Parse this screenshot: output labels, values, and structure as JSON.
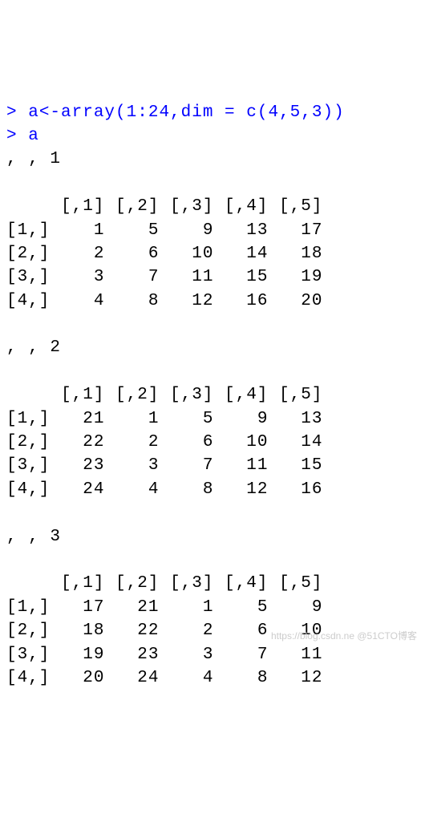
{
  "console": {
    "prompt": ">",
    "lines": [
      {
        "type": "input",
        "text": "a<-array(1:24,dim = c(4,5,3))"
      },
      {
        "type": "input",
        "text": "a"
      }
    ]
  },
  "array_output": {
    "slices": [
      {
        "header": ", , 1",
        "col_labels": [
          "[,1]",
          "[,2]",
          "[,3]",
          "[,4]",
          "[,5]"
        ],
        "row_labels": [
          "[1,]",
          "[2,]",
          "[3,]",
          "[4,]"
        ],
        "values": [
          [
            1,
            5,
            9,
            13,
            17
          ],
          [
            2,
            6,
            10,
            14,
            18
          ],
          [
            3,
            7,
            11,
            15,
            19
          ],
          [
            4,
            8,
            12,
            16,
            20
          ]
        ]
      },
      {
        "header": ", , 2",
        "col_labels": [
          "[,1]",
          "[,2]",
          "[,3]",
          "[,4]",
          "[,5]"
        ],
        "row_labels": [
          "[1,]",
          "[2,]",
          "[3,]",
          "[4,]"
        ],
        "values": [
          [
            21,
            1,
            5,
            9,
            13
          ],
          [
            22,
            2,
            6,
            10,
            14
          ],
          [
            23,
            3,
            7,
            11,
            15
          ],
          [
            24,
            4,
            8,
            12,
            16
          ]
        ]
      },
      {
        "header": ", , 3",
        "col_labels": [
          "[,1]",
          "[,2]",
          "[,3]",
          "[,4]",
          "[,5]"
        ],
        "row_labels": [
          "[1,]",
          "[2,]",
          "[3,]",
          "[4,]"
        ],
        "values": [
          [
            17,
            21,
            1,
            5,
            9
          ],
          [
            18,
            22,
            2,
            6,
            10
          ],
          [
            19,
            23,
            3,
            7,
            11
          ],
          [
            20,
            24,
            4,
            8,
            12
          ]
        ]
      }
    ]
  },
  "watermark": "https://blog.csdn.ne @51CTO博客"
}
